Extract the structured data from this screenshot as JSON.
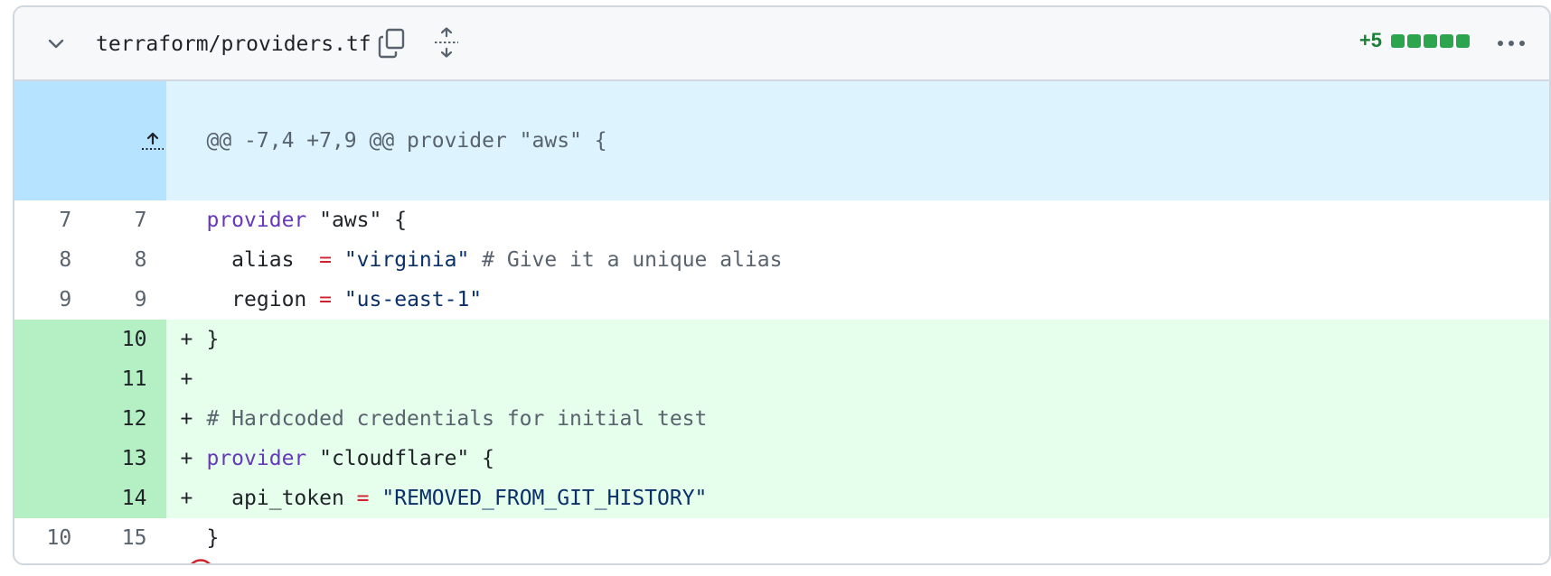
{
  "file": {
    "path": "terraform/providers.tf",
    "additions": "+5",
    "diffstat_blocks": 5,
    "icons": {
      "collapse": "chevron-down-icon",
      "copy": "copy-icon",
      "expand": "unfold-icon",
      "more": "kebab-horizontal-icon",
      "hunk_expand": "fold-up-icon",
      "no_newline": "no-entry-icon"
    },
    "colors": {
      "addition_bg": "#e6ffec",
      "addition_gutter_bg": "#b4f0c4",
      "hunk_bg": "#ddf4ff",
      "keyword": "#6639ba",
      "string": "#0a3069",
      "operator": "#cf222e",
      "stat_green": "#1a7f37",
      "no_newline_red": "#cf222e"
    }
  },
  "hunk": {
    "header": "@@ -7,4 +7,9 @@ provider \"aws\" {"
  },
  "lines": [
    {
      "old": "7",
      "new": "7",
      "marker": "",
      "tokens": [
        {
          "t": "provider",
          "c": "kw"
        },
        {
          "t": " \"aws\" {",
          "c": ""
        }
      ]
    },
    {
      "old": "8",
      "new": "8",
      "marker": "",
      "tokens": [
        {
          "t": "  alias  ",
          "c": ""
        },
        {
          "t": "=",
          "c": "op"
        },
        {
          "t": " ",
          "c": ""
        },
        {
          "t": "\"virginia\"",
          "c": "str"
        },
        {
          "t": " # Give it a unique alias",
          "c": "cmt"
        }
      ]
    },
    {
      "old": "9",
      "new": "9",
      "marker": "",
      "tokens": [
        {
          "t": "  region ",
          "c": ""
        },
        {
          "t": "=",
          "c": "op"
        },
        {
          "t": " ",
          "c": ""
        },
        {
          "t": "\"us-east-1\"",
          "c": "str"
        }
      ]
    },
    {
      "old": "",
      "new": "10",
      "marker": "+",
      "type": "add",
      "tokens": [
        {
          "t": "}",
          "c": ""
        }
      ]
    },
    {
      "old": "",
      "new": "11",
      "marker": "+",
      "type": "add",
      "tokens": []
    },
    {
      "old": "",
      "new": "12",
      "marker": "+",
      "type": "add",
      "tokens": [
        {
          "t": "# Hardcoded credentials for initial test",
          "c": "cmt"
        }
      ]
    },
    {
      "old": "",
      "new": "13",
      "marker": "+",
      "type": "add",
      "tokens": [
        {
          "t": "provider",
          "c": "kw"
        },
        {
          "t": " \"cloudflare\" {",
          "c": ""
        }
      ]
    },
    {
      "old": "",
      "new": "14",
      "marker": "+",
      "type": "add",
      "tokens": [
        {
          "t": "  api_token ",
          "c": ""
        },
        {
          "t": "=",
          "c": "op"
        },
        {
          "t": " ",
          "c": ""
        },
        {
          "t": "\"REMOVED_FROM_GIT_HISTORY\"",
          "c": "str"
        }
      ]
    },
    {
      "old": "10",
      "new": "15",
      "marker": "",
      "tokens": [
        {
          "t": "}",
          "c": ""
        }
      ]
    }
  ]
}
